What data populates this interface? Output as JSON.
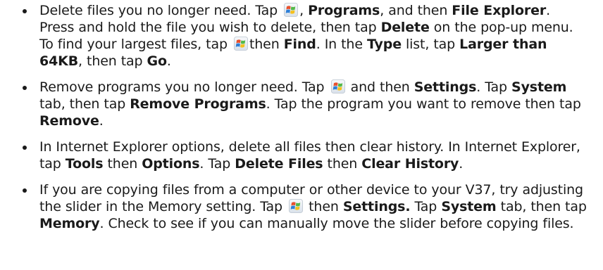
{
  "document": {
    "items": [
      {
        "segments": [
          {
            "t": "Delete files you no longer need. Tap "
          },
          {
            "icon": "windows-start-icon"
          },
          {
            "t": ", "
          },
          {
            "b": "Programs"
          },
          {
            "t": ", and then "
          },
          {
            "b": "File Explorer"
          },
          {
            "t": ". Press and hold the file you wish to delete, then tap "
          },
          {
            "b": "Delete"
          },
          {
            "t": " on the pop-up menu. To find your largest files, tap "
          },
          {
            "icon": "windows-start-icon"
          },
          {
            "t": "then "
          },
          {
            "b": "Find"
          },
          {
            "t": ". In the "
          },
          {
            "b": "Type"
          },
          {
            "t": " list, tap "
          },
          {
            "b": "Larger than 64KB"
          },
          {
            "t": ", then tap "
          },
          {
            "b": "Go"
          },
          {
            "t": "."
          }
        ]
      },
      {
        "segments": [
          {
            "t": "Remove programs you no longer need. Tap "
          },
          {
            "icon": "windows-start-icon"
          },
          {
            "t": " and then "
          },
          {
            "b": "Settings"
          },
          {
            "t": ". Tap "
          },
          {
            "b": "System"
          },
          {
            "t": " tab, then tap "
          },
          {
            "b": "Remove Programs"
          },
          {
            "t": ". Tap the program you want to remove then tap "
          },
          {
            "b": "Remove"
          },
          {
            "t": "."
          }
        ]
      },
      {
        "segments": [
          {
            "t": "In Internet Explorer options, delete all files then clear history. In Internet Explorer, tap "
          },
          {
            "b": "Tools"
          },
          {
            "t": " then "
          },
          {
            "b": "Options"
          },
          {
            "t": ". Tap "
          },
          {
            "b": "Delete Files"
          },
          {
            "t": " then "
          },
          {
            "b": "Clear History"
          },
          {
            "t": "."
          }
        ]
      },
      {
        "segments": [
          {
            "t": "If you are copying files from a computer or other device to your V37, try adjusting the slider in the Memory setting. Tap "
          },
          {
            "icon": "windows-start-icon"
          },
          {
            "t": " then "
          },
          {
            "b": "Settings."
          },
          {
            "t": " Tap "
          },
          {
            "b": "System"
          },
          {
            "t": " tab, then tap "
          },
          {
            "b": "Memory"
          },
          {
            "t": ". Check to see if you can manually move the slider before copying files."
          }
        ]
      }
    ]
  },
  "icons": {
    "windows-start-icon": {
      "colors": {
        "red": "#e8502c",
        "green": "#54b948",
        "blue": "#2f7fd6",
        "yellow": "#f5c01d",
        "bg_top": "#f7f9fb",
        "bg_bottom": "#d9e1ea"
      }
    }
  }
}
